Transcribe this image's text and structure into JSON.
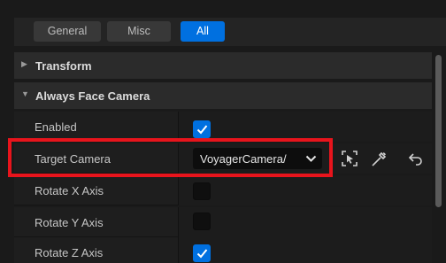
{
  "tabs": [
    {
      "label": "General",
      "active": false
    },
    {
      "label": "Misc",
      "active": false
    },
    {
      "label": "All",
      "active": true
    }
  ],
  "sections": {
    "transform": {
      "title": "Transform",
      "expanded": false
    },
    "always_face_camera": {
      "title": "Always Face Camera",
      "expanded": true
    }
  },
  "properties": {
    "enabled": {
      "label": "Enabled",
      "checked": true
    },
    "target_camera": {
      "label": "Target Camera",
      "value": "VoyagerCamera/"
    },
    "rotate_x": {
      "label": "Rotate X Axis",
      "checked": false
    },
    "rotate_y": {
      "label": "Rotate Y Axis",
      "checked": false
    },
    "rotate_z": {
      "label": "Rotate Z Axis",
      "checked": true
    }
  },
  "icons": {
    "dropdown": "chevron-down-icon",
    "pick_actor": "pick-target-icon",
    "eyedropper": "eyedropper-icon",
    "reset": "reset-arrow-icon",
    "collapsed": "triangle-right-icon",
    "expanded": "triangle-down-icon",
    "check": "check-icon"
  },
  "colors": {
    "accent": "#0070e0",
    "highlight": "#e8141c",
    "background": "#1a1a1a"
  }
}
